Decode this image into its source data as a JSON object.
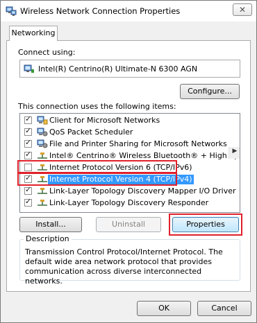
{
  "window": {
    "title": "Wireless Network Connection Properties",
    "close_glyph": "✕"
  },
  "tab": {
    "label": "Networking"
  },
  "connect_using": {
    "label": "Connect using:",
    "adapter": "Intel(R) Centrino(R) Ultimate-N 6300 AGN"
  },
  "buttons": {
    "configure": "Configure...",
    "install": "Install...",
    "uninstall": "Uninstall",
    "properties": "Properties",
    "ok": "OK",
    "cancel": "Cancel"
  },
  "items_label": "This connection uses the following items:",
  "items": [
    {
      "label": "Client for Microsoft Networks",
      "checked": true,
      "icon": "network-client-icon"
    },
    {
      "label": "QoS Packet Scheduler",
      "checked": true,
      "icon": "network-service-icon"
    },
    {
      "label": "File and Printer Sharing for Microsoft Networks",
      "checked": true,
      "icon": "network-service-icon"
    },
    {
      "label": "Intel® Centrino® Wireless Bluetooth® + High Speed Pro...",
      "checked": true,
      "icon": "protocol-icon"
    },
    {
      "label": "Internet Protocol Version 6 (TCP/IPv6)",
      "checked": false,
      "icon": "protocol-icon"
    },
    {
      "label": "Internet Protocol Version 4 (TCP/IPv4)",
      "checked": true,
      "icon": "protocol-icon",
      "selected": true
    },
    {
      "label": "Link-Layer Topology Discovery Mapper I/O Driver",
      "checked": true,
      "icon": "protocol-icon"
    },
    {
      "label": "Link-Layer Topology Discovery Responder",
      "checked": true,
      "icon": "protocol-icon"
    }
  ],
  "description": {
    "legend": "Description",
    "text": "Transmission Control Protocol/Internet Protocol. The default wide area network protocol that provides communication across diverse interconnected networks."
  },
  "colors": {
    "selection": "#3399ff",
    "highlight_box": "#e0202a"
  }
}
